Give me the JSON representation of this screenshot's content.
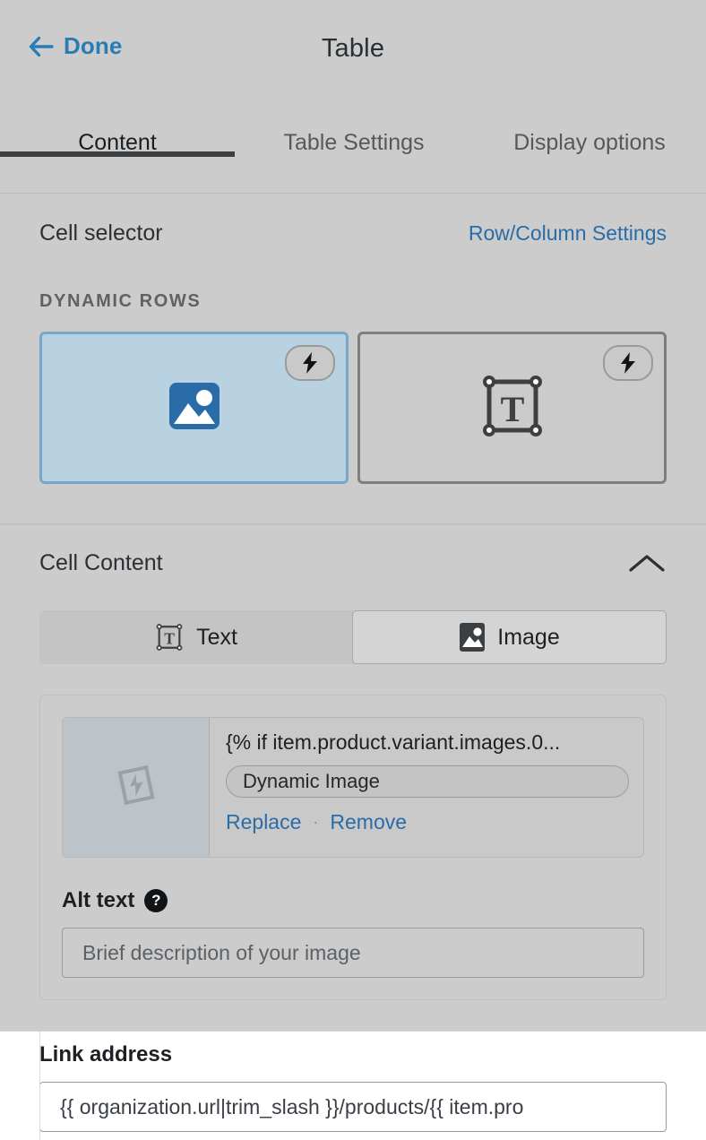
{
  "header": {
    "back_label": "Done",
    "back_icon": "arrow-left-icon",
    "title": "Table"
  },
  "tabs": [
    {
      "label": "Content",
      "active": true
    },
    {
      "label": "Table Settings",
      "active": false
    },
    {
      "label": "Display options",
      "active": false
    }
  ],
  "cell_selector": {
    "title": "Cell selector",
    "row_column_link": "Row/Column Settings",
    "group_label": "DYNAMIC ROWS",
    "cells": [
      {
        "name": "image-cell",
        "icon": "image-icon",
        "badge_icon": "lightning-bolt-icon",
        "selected": true
      },
      {
        "name": "text-cell",
        "icon": "text-box-icon",
        "badge_icon": "lightning-bolt-icon",
        "selected": false
      }
    ]
  },
  "cell_content": {
    "title": "Cell Content",
    "collapse_icon": "chevron-up-icon",
    "segments": [
      {
        "label": "Text",
        "icon": "text-box-icon",
        "selected": false
      },
      {
        "label": "Image",
        "icon": "image-icon",
        "selected": true
      }
    ],
    "asset": {
      "thumbnail_icon": "dynamic-image-placeholder-icon",
      "name": "{% if item.product.variant.images.0...",
      "badge": "Dynamic Image",
      "replace_label": "Replace",
      "separator": "·",
      "remove_label": "Remove"
    },
    "alt_text": {
      "label": "Alt text",
      "help_icon": "question-mark-icon",
      "help_glyph": "?",
      "placeholder": "Brief description of your image",
      "value": ""
    }
  },
  "link_address": {
    "label": "Link address",
    "value": "{{ organization.url|trim_slash }}/products/{{ item.pro",
    "placeholder": ""
  },
  "colors": {
    "panel_bg": "#cccccc",
    "accent_link": "#2a6ca8",
    "done_link": "#2a7cb5",
    "selected_cell_bg": "#b9d2e2",
    "selected_cell_border": "#79a7c9",
    "image_icon_blue": "#2a6ca8",
    "active_tab_underline": "#3c4043",
    "sheet_bg": "#ffffff"
  }
}
